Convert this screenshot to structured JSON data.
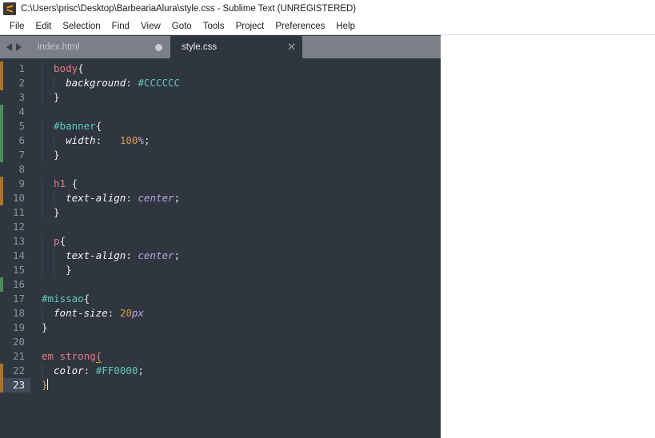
{
  "window": {
    "title": "C:\\Users\\prisc\\Desktop\\BarbeariaAlura\\style.css - Sublime Text (UNREGISTERED)",
    "app_icon": "sublime-text-logo-icon"
  },
  "menubar": {
    "items": [
      {
        "label": "File"
      },
      {
        "label": "Edit"
      },
      {
        "label": "Selection"
      },
      {
        "label": "Find"
      },
      {
        "label": "View"
      },
      {
        "label": "Goto"
      },
      {
        "label": "Tools"
      },
      {
        "label": "Project"
      },
      {
        "label": "Preferences"
      },
      {
        "label": "Help"
      }
    ]
  },
  "tabbar": {
    "nav_prev_icon": "arrow-left-icon",
    "nav_next_icon": "arrow-right-icon",
    "tabs": [
      {
        "label": "index.html",
        "active": false,
        "modified": true
      },
      {
        "label": "style.css",
        "active": true,
        "modified": false,
        "close_icon": "close-icon"
      }
    ]
  },
  "editor": {
    "filename": "style.css",
    "cursor_line": 23,
    "total_lines": 23,
    "colors": {
      "background": "#2f3640",
      "gutter_text": "#8b939e",
      "current_line_gutter_bg": "#414a57",
      "selector_element": "#e07b82",
      "selector_id": "#5fc9b8",
      "property": "#f2f3f4",
      "value_keyword": "#b9a8e0",
      "number": "#dd9c4a",
      "hex_color": "#5fc9b8",
      "punctuation": "#e8eaec",
      "git_modified": "#a8742c",
      "git_added": "#4f8a5b"
    },
    "lines": [
      {
        "n": 1,
        "indent": 2,
        "gutter": "modified",
        "guides": [
          1
        ],
        "tokens": [
          {
            "t": "sel",
            "v": "body"
          },
          {
            "t": "punct",
            "v": "{"
          }
        ]
      },
      {
        "n": 2,
        "indent": 4,
        "gutter": "modified",
        "guides": [
          1,
          2
        ],
        "tokens": [
          {
            "t": "prop",
            "v": "background"
          },
          {
            "t": "punct",
            "v": ":"
          },
          {
            "t": "plain",
            "v": " "
          },
          {
            "t": "hex",
            "v": "#CCCCCC"
          }
        ]
      },
      {
        "n": 3,
        "indent": 2,
        "gutter": "none",
        "guides": [
          1
        ],
        "tokens": [
          {
            "t": "punct",
            "v": "}"
          }
        ]
      },
      {
        "n": 4,
        "indent": 0,
        "gutter": "added",
        "guides": [],
        "tokens": []
      },
      {
        "n": 5,
        "indent": 2,
        "gutter": "added",
        "guides": [
          1
        ],
        "tokens": [
          {
            "t": "id",
            "v": "#banner"
          },
          {
            "t": "punct",
            "v": "{"
          }
        ]
      },
      {
        "n": 6,
        "indent": 4,
        "gutter": "added",
        "guides": [
          1,
          2
        ],
        "tokens": [
          {
            "t": "prop",
            "v": "width"
          },
          {
            "t": "punct",
            "v": ":"
          },
          {
            "t": "plain",
            "v": "   "
          },
          {
            "t": "num",
            "v": "100"
          },
          {
            "t": "unit",
            "v": "%"
          },
          {
            "t": "punct",
            "v": ";"
          }
        ]
      },
      {
        "n": 7,
        "indent": 2,
        "gutter": "added",
        "guides": [
          1
        ],
        "tokens": [
          {
            "t": "punct",
            "v": "}"
          }
        ]
      },
      {
        "n": 8,
        "indent": 0,
        "gutter": "none",
        "guides": [],
        "tokens": []
      },
      {
        "n": 9,
        "indent": 2,
        "gutter": "modified",
        "guides": [
          1
        ],
        "tokens": [
          {
            "t": "sel",
            "v": "h1"
          },
          {
            "t": "plain",
            "v": " "
          },
          {
            "t": "punct",
            "v": "{"
          }
        ]
      },
      {
        "n": 10,
        "indent": 4,
        "gutter": "modified",
        "guides": [
          1,
          2
        ],
        "tokens": [
          {
            "t": "prop",
            "v": "text-align"
          },
          {
            "t": "punct",
            "v": ":"
          },
          {
            "t": "plain",
            "v": " "
          },
          {
            "t": "val",
            "v": "center"
          },
          {
            "t": "punct",
            "v": ";"
          }
        ]
      },
      {
        "n": 11,
        "indent": 2,
        "gutter": "none",
        "guides": [
          1
        ],
        "tokens": [
          {
            "t": "punct",
            "v": "}"
          }
        ]
      },
      {
        "n": 12,
        "indent": 0,
        "gutter": "none",
        "guides": [],
        "tokens": []
      },
      {
        "n": 13,
        "indent": 2,
        "gutter": "none",
        "guides": [
          1
        ],
        "tokens": [
          {
            "t": "sel",
            "v": "p"
          },
          {
            "t": "punct",
            "v": "{"
          }
        ]
      },
      {
        "n": 14,
        "indent": 4,
        "gutter": "none",
        "guides": [
          1,
          2
        ],
        "tokens": [
          {
            "t": "prop",
            "v": "text-align"
          },
          {
            "t": "punct",
            "v": ":"
          },
          {
            "t": "plain",
            "v": " "
          },
          {
            "t": "val",
            "v": "center"
          },
          {
            "t": "punct",
            "v": ";"
          }
        ]
      },
      {
        "n": 15,
        "indent": 4,
        "gutter": "none",
        "guides": [
          1,
          2
        ],
        "tokens": [
          {
            "t": "punct",
            "v": "}"
          }
        ]
      },
      {
        "n": 16,
        "indent": 0,
        "gutter": "added",
        "guides": [],
        "tokens": []
      },
      {
        "n": 17,
        "indent": 0,
        "gutter": "none",
        "guides": [],
        "tokens": [
          {
            "t": "id",
            "v": "#missao"
          },
          {
            "t": "punct",
            "v": "{"
          }
        ]
      },
      {
        "n": 18,
        "indent": 2,
        "gutter": "none",
        "guides": [
          1
        ],
        "tokens": [
          {
            "t": "prop",
            "v": "font-size"
          },
          {
            "t": "punct",
            "v": ":"
          },
          {
            "t": "plain",
            "v": " "
          },
          {
            "t": "num",
            "v": "20"
          },
          {
            "t": "unit",
            "v": "px"
          }
        ]
      },
      {
        "n": 19,
        "indent": 0,
        "gutter": "none",
        "guides": [],
        "tokens": [
          {
            "t": "punct",
            "v": "}"
          }
        ]
      },
      {
        "n": 20,
        "indent": 0,
        "gutter": "none",
        "guides": [],
        "tokens": []
      },
      {
        "n": 21,
        "indent": 0,
        "gutter": "none",
        "guides": [],
        "tokens": [
          {
            "t": "sel",
            "v": "em"
          },
          {
            "t": "plain",
            "v": " "
          },
          {
            "t": "sel",
            "v": "strong"
          },
          {
            "t": "bracematch",
            "v": "{"
          }
        ]
      },
      {
        "n": 22,
        "indent": 2,
        "gutter": "modified",
        "guides": [
          1
        ],
        "tokens": [
          {
            "t": "prop",
            "v": "color"
          },
          {
            "t": "punct",
            "v": ":"
          },
          {
            "t": "plain",
            "v": " "
          },
          {
            "t": "hex",
            "v": "#FF0000"
          },
          {
            "t": "punct",
            "v": ";"
          }
        ]
      },
      {
        "n": 23,
        "indent": 0,
        "gutter": "modified",
        "guides": [],
        "current": true,
        "caret_after": true,
        "tokens": [
          {
            "t": "braceun",
            "v": "}"
          }
        ]
      }
    ]
  }
}
